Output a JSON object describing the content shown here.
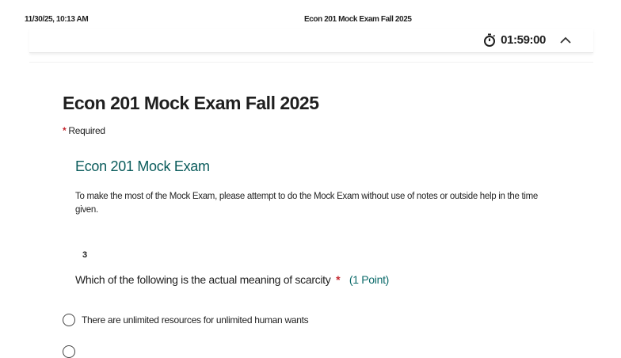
{
  "print_header": {
    "datetime": "11/30/25, 10:13 AM",
    "title": "Econ 201 Mock Exam Fall 2025"
  },
  "timer": {
    "icon": "stopwatch-icon",
    "value": "01:59:00"
  },
  "collapse_icon": "chevron-up-icon",
  "form": {
    "title": "Econ 201 Mock Exam Fall 2025",
    "required_asterisk": "*",
    "required_label": "Required"
  },
  "section": {
    "title": "Econ 201 Mock Exam",
    "description": "To make the most of the Mock Exam, please attempt to do the Mock Exam without use of notes or outside help in the time given."
  },
  "question": {
    "number": "3",
    "text": "Which of the following is the actual meaning of scarcity",
    "required_marker": "*",
    "points": "(1 Point)",
    "options": [
      {
        "label": "There are unlimited resources for unlimited human wants"
      }
    ]
  },
  "colors": {
    "accent_teal": "#0b5c5c",
    "required_red": "#c4262e"
  }
}
